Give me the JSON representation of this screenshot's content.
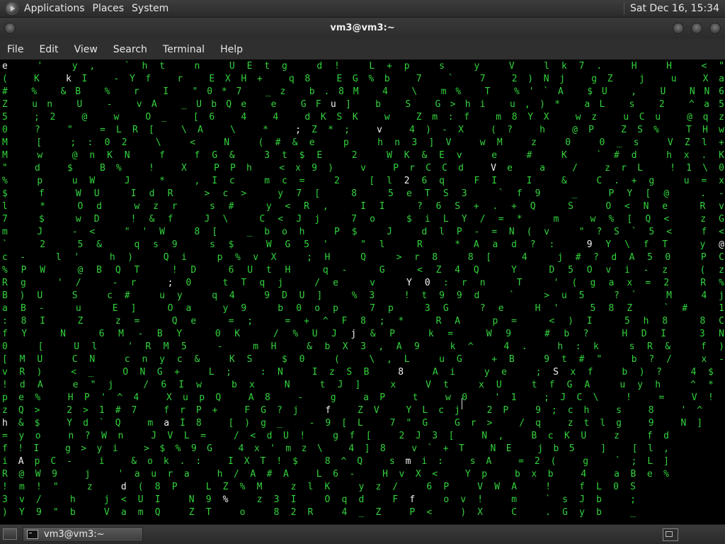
{
  "top_panel": {
    "menus": [
      "Applications",
      "Places",
      "System"
    ],
    "clock": "Sat Dec 16, 15:34"
  },
  "window": {
    "title": "vm3@vm3:~"
  },
  "menubar": {
    "items": [
      "File",
      "Edit",
      "View",
      "Search",
      "Terminal",
      "Help"
    ]
  },
  "taskbar": {
    "task_label": "vm3@vm3:~"
  },
  "terminal": {
    "colors": {
      "fg": "#32d23c",
      "highlight": "#f2f2f2",
      "bg": "#000000"
    },
    "rows": [
      "e    '  y,      `ht n   UEtg  d! L+p   s  y   V    lk7.  H   H     <\"  ",
      "(    K  kI      -Yf r   EXH+  q8 EG%b  7  ` 7      2)Nj  gZ  j u   Xa  ",
      "#    %  &B      % r I   \"0*7  _z b.8M  4  \\ m% T   %'`A  $U  , U   NN6 ",
      "Z       un      U - vA  _UbQe e  GFu]  b  S G>hi   u,)*  aL  s 2   ^a5 ",
      "5       ;2      @ w O_  [6 4  4  dKSK  w    Zm:f   m8YX  wz  uCu   @qz ",
      "0       ?       \" =LR[  \\A \\ *  ;Z*;  v    4)-X   (? h  @P  ZS%   THw ",
      "        M       [ ;:02  \\  < N  (#&e  p    hn3]V  wM z   0   0_s   VZl+",
      "        M       w @nKN  f  fG&  3t$E  2    WK&Ev  e  #  K   `#d   hx.K",
      "\"       d       $ B% !  X  PPh  <x9)  v    PrCCd  Ve a  /   zrL   !1\\0",
      "%               p uW J  *  ,Ic  mc=   2    [l26q  FI I  &   C.+g  u=x ",
      "$               f WU IdR   >c>  y7[   8     5eTS3 `f9   _   PY[@  .-  ",
      "l               * Od wzr   s#  y<R,  II     ?6S+.+Q S       O<Ne  Rv  ",
      "7               $ wD !&f   J\\ C<Jj  7o     $iLY/=* m   w%[Q<  zG  ",
      "m               J -< \"'W   8[ _boh  P$   J  dlP-=N(v    \"?S`5<  f<  ",
      "`               2 5& qs9   s$ WG5'  \"l   R  *Aad?:    9Y\\fT  y@  ",
      "c-                l' h)   Qi p%vX  ;H   Q  >r8 8[ 4   j#?dA50  PC  ",
      "%PW               @BQT    !D 6UtH  q-   G  <Z4Q  Y   D5Ovi-z  (z  ",
      "Rg                '/ -r   ;0 tTqj  /e   v  Y0:rn T   '(gax=2  R%  ",
      "B)U      S        c# uy   q4 9DU]  %3     !t99d `   >u5 ?` M  4j  ",
      "aB-      u        E] Oa   y9 b0op  7p     3G ?e  H'  58Z `#   1   ",
      ":8I      Z        z= Qe   =; =+^F8;*     RA p=   <)I 5h8 8C      ",
      " fY      N        6M-BY   0K /%UJj&P     k= W9   #b? HDI 3N      ",
      "  0 [    Ul       'RM5 -  mH &bX3,A9     k^ 4.   h:k sR& f)      ",
      "  [MU    CN       cnyc&   KS $0 ( \\,L     uG +B  9t#\" b?/ x-      ",
      "  vR)    <_       ONG+    L; :N IzSB 8  Ai ye  ;Sxf b)? 4$      ",
      "  !dA    e\"j      /6Iw    bx  N tJ]  x  Vt xU  tfGA uyh ^*      ",
      "  pe%  HP'^4      XupQ    A8  - g aP t  w0 '1  ;JC\\ ! = V!      ",
      "  zQ>  2>1#7      frP+    FG?j f ZV YLcj 2P  9;ch s 8 '^       ",
      "  h&$  Yd`Q       maI8  [)g_ -9[L 7\"G Gr> /q  ztlg 9   N]      ",
      "  =yo  n?Wn       JVL=  /<dU! gf[ 2J3[ N,  BcKU z   fd      ",
      "  f!I g>yi       >$%9G 4x'mz\\ 4]8 v`+T NE  jb5 ]   [l,      ",
      "  iApC- i        &ok.: IXT!$ 8^Q smi: sA  =2( g   `;L]      ",
      "  R@W9 j         'aura h/A#A L6- HvX< Yp  bxb 4   aBe%      ",
      "  !m!\" z         d(8P LZ%M zlK yz/ 6P  VWA !   fL0S      ",
      "  3v/ h          j<UI N9%  z3I Oqd Ff  ov! m   `sJb ;    ",
      "  )Y9\"b          VamQ ZT o  82R 4_Z P<  )X C   .Gyb _    "
    ],
    "bright_chars": [
      "Y",
      "b",
      "A",
      "s",
      "S",
      "V",
      "z",
      "K",
      "d",
      "e",
      "k",
      "l",
      "x",
      "@",
      "v",
      "h",
      "9",
      "m",
      ";",
      "u",
      "B",
      "a",
      "i",
      "'",
      "1",
      "2",
      "P",
      "8",
      "j",
      "0",
      "f",
      "o",
      "%",
      "y",
      "L"
    ]
  }
}
